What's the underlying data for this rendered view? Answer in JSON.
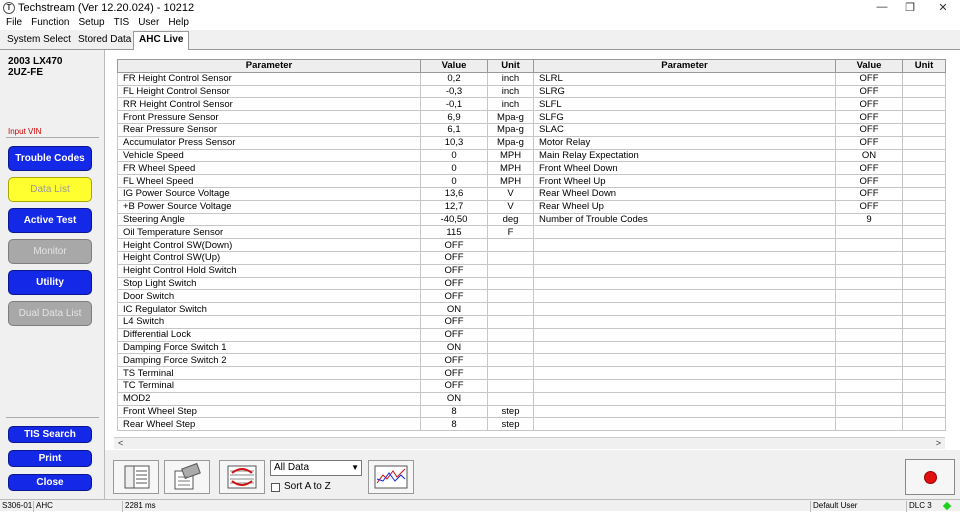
{
  "window": {
    "title": "Techstream (Ver 12.20.024) - 10212",
    "logo_letter": "T",
    "minimize": "—",
    "maximize": "❐",
    "close": "✕"
  },
  "menu": [
    "File",
    "Function",
    "Setup",
    "TIS",
    "User",
    "Help"
  ],
  "tabs": [
    "System Select",
    "Stored Data",
    "AHC Live"
  ],
  "sidebar": {
    "vehicle_model": "2003 LX470",
    "vehicle_engine": "2UZ-FE",
    "input_vin": "Input VIN",
    "buttons": [
      "Trouble Codes",
      "Data List",
      "Active Test",
      "Monitor",
      "Utility",
      "Dual Data List"
    ],
    "tis_search": "TIS Search",
    "print": "Print",
    "close": "Close"
  },
  "table": {
    "headers": {
      "parameter": "Parameter",
      "value": "Value",
      "unit": "Unit"
    },
    "left_rows": [
      [
        "FR Height Control Sensor",
        "0,2",
        "inch"
      ],
      [
        "FL Height Control Sensor",
        "-0,3",
        "inch"
      ],
      [
        "RR Height Control Sensor",
        "-0,1",
        "inch"
      ],
      [
        "Front Pressure Sensor",
        "6,9",
        "Mpa-g"
      ],
      [
        "Rear Pressure Sensor",
        "6,1",
        "Mpa-g"
      ],
      [
        "Accumulator Press Sensor",
        "10,3",
        "Mpa-g"
      ],
      [
        "Vehicle Speed",
        "0",
        "MPH"
      ],
      [
        "FR Wheel Speed",
        "0",
        "MPH"
      ],
      [
        "FL Wheel Speed",
        "0",
        "MPH"
      ],
      [
        "IG Power Source Voltage",
        "13,6",
        "V"
      ],
      [
        "+B Power Source Voltage",
        "12,7",
        "V"
      ],
      [
        "Steering Angle",
        "-40,50",
        "deg"
      ],
      [
        "Oil Temperature Sensor",
        "115",
        "F"
      ],
      [
        "Height Control SW(Down)",
        "OFF",
        ""
      ],
      [
        "Height Control SW(Up)",
        "OFF",
        ""
      ],
      [
        "Height Control Hold Switch",
        "OFF",
        ""
      ],
      [
        "Stop Light Switch",
        "OFF",
        ""
      ],
      [
        "Door Switch",
        "OFF",
        ""
      ],
      [
        "IC Regulator Switch",
        "ON",
        ""
      ],
      [
        "L4 Switch",
        "OFF",
        ""
      ],
      [
        "Differential Lock",
        "OFF",
        ""
      ],
      [
        "Damping Force Switch 1",
        "ON",
        ""
      ],
      [
        "Damping Force Switch 2",
        "OFF",
        ""
      ],
      [
        "TS Terminal",
        "OFF",
        ""
      ],
      [
        "TC Terminal",
        "OFF",
        ""
      ],
      [
        "MOD2",
        "ON",
        ""
      ],
      [
        "Front Wheel Step",
        "8",
        "step"
      ],
      [
        "Rear Wheel Step",
        "8",
        "step"
      ]
    ],
    "right_rows": [
      [
        "SLRL",
        "OFF",
        ""
      ],
      [
        "SLRG",
        "OFF",
        ""
      ],
      [
        "SLFL",
        "OFF",
        ""
      ],
      [
        "SLFG",
        "OFF",
        ""
      ],
      [
        "SLAC",
        "OFF",
        ""
      ],
      [
        "Motor Relay",
        "OFF",
        ""
      ],
      [
        "Main Relay Expectation",
        "ON",
        ""
      ],
      [
        "Front Wheel Down",
        "OFF",
        ""
      ],
      [
        "Front Wheel Up",
        "OFF",
        ""
      ],
      [
        "Rear Wheel Down",
        "OFF",
        ""
      ],
      [
        "Rear Wheel Up",
        "OFF",
        ""
      ],
      [
        "Number of Trouble Codes",
        "9",
        ""
      ],
      [
        "",
        "",
        ""
      ],
      [
        "",
        "",
        ""
      ],
      [
        "",
        "",
        ""
      ],
      [
        "",
        "",
        ""
      ],
      [
        "",
        "",
        ""
      ],
      [
        "",
        "",
        ""
      ],
      [
        "",
        "",
        ""
      ],
      [
        "",
        "",
        ""
      ],
      [
        "",
        "",
        ""
      ],
      [
        "",
        "",
        ""
      ],
      [
        "",
        "",
        ""
      ],
      [
        "",
        "",
        ""
      ],
      [
        "",
        "",
        ""
      ],
      [
        "",
        "",
        ""
      ],
      [
        "",
        "",
        ""
      ],
      [
        "",
        "",
        ""
      ]
    ]
  },
  "scroll": {
    "left": "<",
    "right": ">"
  },
  "toolbar": {
    "filter_selected": "All Data",
    "sort_label": "Sort A to Z"
  },
  "status_bar": [
    "S306-01",
    "AHC",
    "2281 ms",
    "Default User",
    "DLC 3"
  ],
  "colors": {
    "blue_button": "#1428e8",
    "yellow_button": "#ffff30",
    "gray_button": "#a8a8a8",
    "record": "#e01010",
    "connection_ok": "#1bd41b"
  }
}
